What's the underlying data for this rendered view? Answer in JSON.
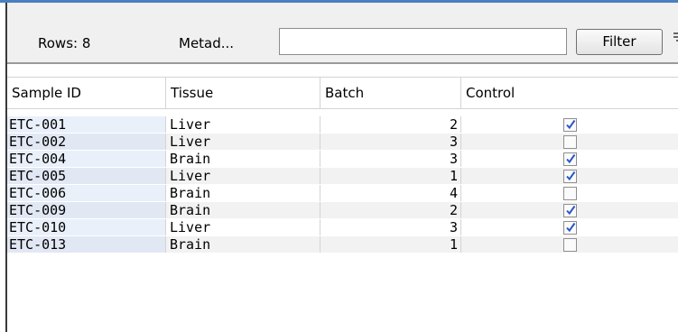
{
  "toolbar": {
    "rows_label": "Rows: 8",
    "metadata_label": "Metad...",
    "search_value": "",
    "search_placeholder": "",
    "filter_label": "Filter",
    "filter_icon": "filter-lines-icon"
  },
  "table": {
    "columns": [
      "Sample ID",
      "Tissue",
      "Batch",
      "Control"
    ],
    "rows": [
      {
        "sample_id": "ETC-001",
        "tissue": "Liver",
        "batch": "2",
        "control": true
      },
      {
        "sample_id": "ETC-002",
        "tissue": "Liver",
        "batch": "3",
        "control": false
      },
      {
        "sample_id": "ETC-004",
        "tissue": "Brain",
        "batch": "3",
        "control": true
      },
      {
        "sample_id": "ETC-005",
        "tissue": "Liver",
        "batch": "1",
        "control": true
      },
      {
        "sample_id": "ETC-006",
        "tissue": "Brain",
        "batch": "4",
        "control": false
      },
      {
        "sample_id": "ETC-009",
        "tissue": "Brain",
        "batch": "2",
        "control": true
      },
      {
        "sample_id": "ETC-010",
        "tissue": "Liver",
        "batch": "3",
        "control": true
      },
      {
        "sample_id": "ETC-013",
        "tissue": "Brain",
        "batch": "1",
        "control": false
      }
    ]
  },
  "colors": {
    "accent_line": "#4a7fc1",
    "checkmark": "#2a56c6",
    "id_column_bg": "#e9f0fa"
  }
}
